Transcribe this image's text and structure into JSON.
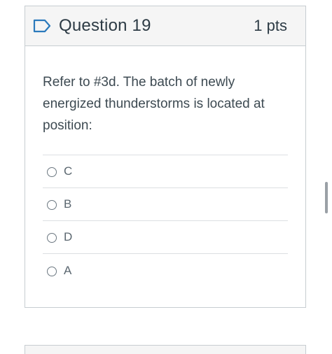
{
  "question": {
    "title": "Question 19",
    "points": "1 pts",
    "flag_icon": "flag-icon",
    "text": "Refer to #3d. The batch of newly energized thunderstorms is located at position:",
    "answers": [
      {
        "label": "C"
      },
      {
        "label": "B"
      },
      {
        "label": "D"
      },
      {
        "label": "A"
      }
    ]
  },
  "colors": {
    "header_bg": "#f5f5f5",
    "border": "#c7cdd1",
    "flag": "#2b7abc",
    "text": "#2d3b45"
  }
}
